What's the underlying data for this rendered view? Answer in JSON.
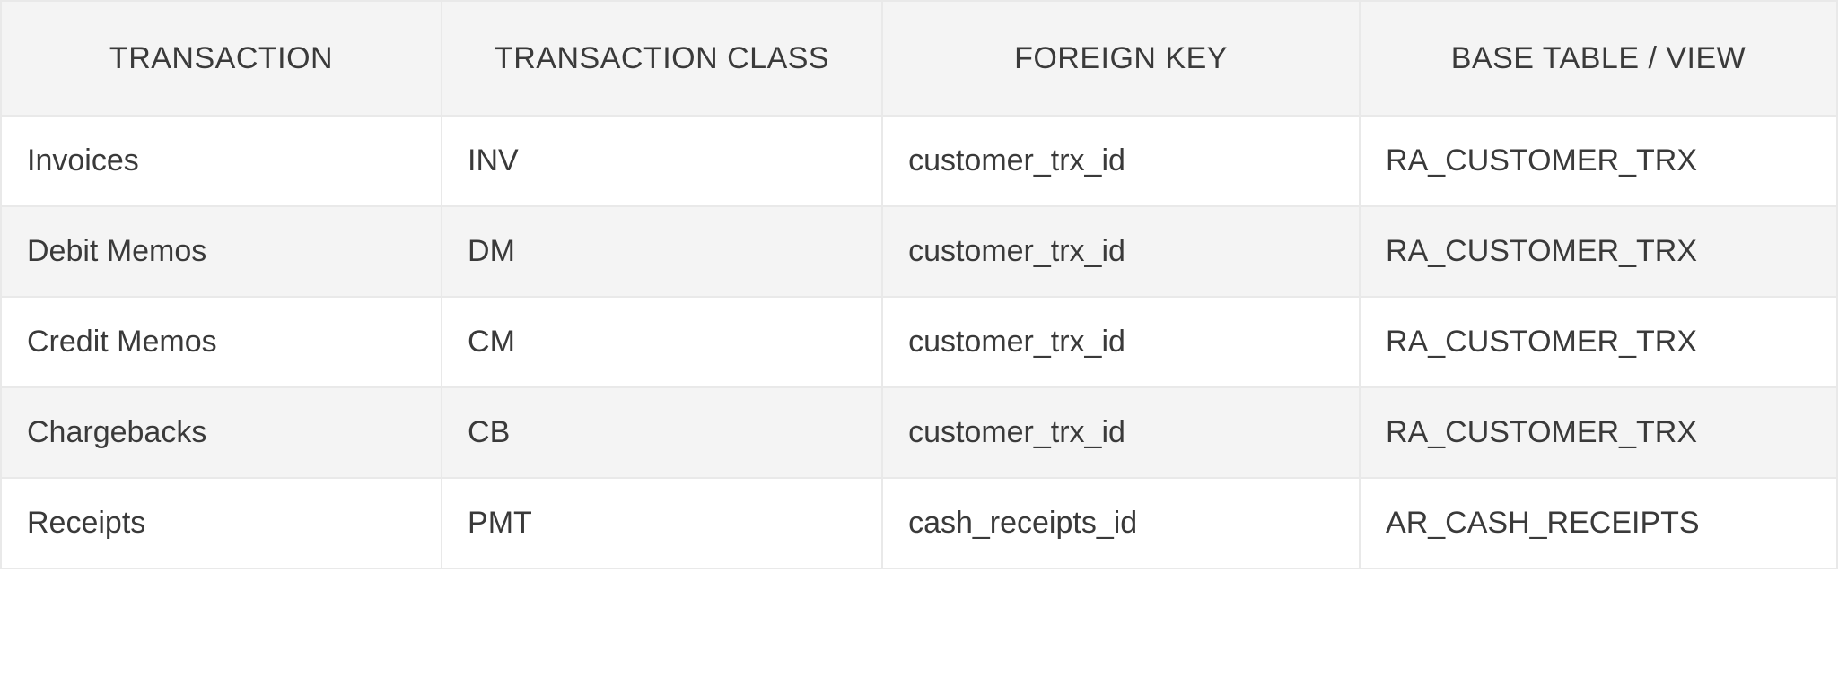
{
  "table": {
    "headers": {
      "transaction": "TRANSACTION",
      "transaction_class": "TRANSACTION CLASS",
      "foreign_key": "FOREIGN KEY",
      "base_table_view": "BASE TABLE / VIEW"
    },
    "rows": [
      {
        "transaction": "Invoices",
        "transaction_class": "INV",
        "foreign_key": "customer_trx_id",
        "base_table_view": "RA_CUSTOMER_TRX"
      },
      {
        "transaction": "Debit Memos",
        "transaction_class": "DM",
        "foreign_key": "customer_trx_id",
        "base_table_view": "RA_CUSTOMER_TRX"
      },
      {
        "transaction": "Credit Memos",
        "transaction_class": "CM",
        "foreign_key": "customer_trx_id",
        "base_table_view": "RA_CUSTOMER_TRX"
      },
      {
        "transaction": "Chargebacks",
        "transaction_class": "CB",
        "foreign_key": "customer_trx_id",
        "base_table_view": "RA_CUSTOMER_TRX"
      },
      {
        "transaction": "Receipts",
        "transaction_class": "PMT",
        "foreign_key": "cash_receipts_id",
        "base_table_view": "AR_CASH_RECEIPTS"
      }
    ]
  }
}
